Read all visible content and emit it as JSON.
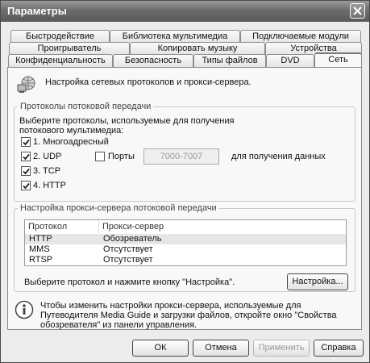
{
  "window": {
    "title": "Параметры"
  },
  "tabs": {
    "row1": [
      "Быстродействие",
      "Библиотека мультимедиа",
      "Подключаемые модули"
    ],
    "row2": [
      "Проигрыватель",
      "Копировать музыку",
      "Устройства"
    ],
    "row3": [
      "Конфиденциальность",
      "Безопасность",
      "Типы файлов",
      "DVD",
      "Сеть"
    ]
  },
  "network": {
    "header": "Настройка сетевых протоколов и прокси-сервера.",
    "streaming": {
      "legend": "Протоколы потоковой передачи",
      "description": "Выберите протоколы, используемые для получения потокового мультимедиа:",
      "protocols": [
        {
          "label": "1. Многоадресный",
          "checked": true
        },
        {
          "label": "2. UDP",
          "checked": true
        },
        {
          "label": "3. TCP",
          "checked": true
        },
        {
          "label": "4. HTTP",
          "checked": true
        }
      ],
      "ports_label": "Порты",
      "ports_checked": false,
      "ports_value": "7000-7007",
      "ports_suffix": "для получения данных"
    },
    "proxy": {
      "legend": "Настройка прокси-сервера потоковой передачи",
      "columns": [
        "Протокол",
        "Прокси-сервер"
      ],
      "rows": [
        {
          "protocol": "HTTP",
          "proxy": "Обозреватель"
        },
        {
          "protocol": "MMS",
          "proxy": "Отсутствует"
        },
        {
          "protocol": "RTSP",
          "proxy": "Отсутствует"
        }
      ],
      "hint": "Выберите протокол и нажмите кнопку \"Настройка\".",
      "configure_label": "Настройка..."
    },
    "info": "Чтобы изменить настройки прокси-сервера, используемые для Путеводителя Media Guide и загрузки файлов, откройте окно \"Свойства обозревателя\" из панели управления."
  },
  "buttons": {
    "ok": "ОК",
    "cancel": "Отмена",
    "apply": "Применить",
    "help": "Справка"
  },
  "colors": {
    "titlebar": "#6c6c6c",
    "dialog": "#ececec",
    "panel": "#f8f8f8"
  }
}
